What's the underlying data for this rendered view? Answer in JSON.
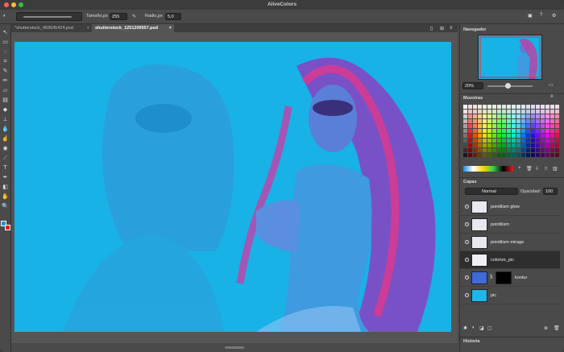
{
  "window": {
    "title": "AliveColors"
  },
  "options": {
    "size_label": "Tamaño,px",
    "size_value": "255",
    "radius_label": "Radio,px",
    "radius_value": "5,0"
  },
  "tabs": [
    {
      "label": "*shutterstock_459645424.psd"
    },
    {
      "label": "shutterstock_1251209557.psd"
    }
  ],
  "tab_close": "×",
  "navigator": {
    "title": "Navegador",
    "zoom": "20%"
  },
  "swatches": {
    "title": "Muestras"
  },
  "layers": {
    "title": "Capas",
    "blend_mode": "Normal",
    "opacity_label": "Opacidad:",
    "opacity_value": "100",
    "items": [
      {
        "name": "pointilism glow"
      },
      {
        "name": "pointilism"
      },
      {
        "name": "pointilism mirage"
      },
      {
        "name": "colorize_pic"
      },
      {
        "name": "kontur"
      },
      {
        "name": "pic"
      }
    ]
  },
  "history": {
    "title": "Historia"
  },
  "colors": {
    "canvas_bg": "#18b2e6",
    "fg_color": "#1a8fe0",
    "bg_color": "#e02020"
  },
  "icons": [
    "brush-icon",
    "selection-icon",
    "crop-icon",
    "move-icon",
    "eraser-icon",
    "gradient-icon",
    "text-icon",
    "hand-icon",
    "zoom-icon"
  ]
}
